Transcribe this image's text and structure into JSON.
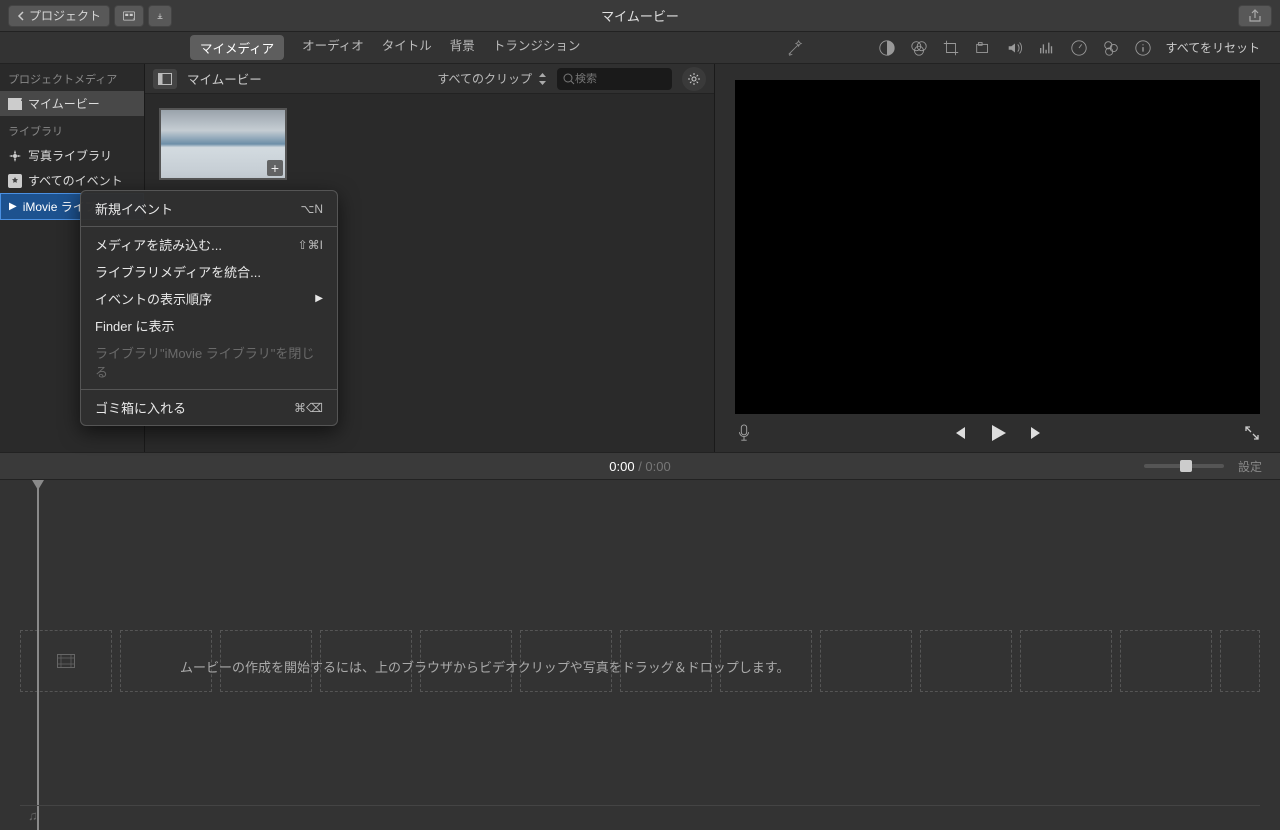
{
  "toolbar": {
    "back_label": "プロジェクト",
    "title": "マイムービー"
  },
  "tabs": {
    "my_media": "マイメディア",
    "audio": "オーディオ",
    "title": "タイトル",
    "bg": "背景",
    "transition": "トランジション"
  },
  "view_tools": {
    "reset_all": "すべてをリセット"
  },
  "sidebar": {
    "project_media_header": "プロジェクトメディア",
    "my_movie": "マイムービー",
    "library_header": "ライブラリ",
    "photo_library": "写真ライブラリ",
    "all_events": "すべてのイベント",
    "imovie_library": "iMovie ライブ..."
  },
  "browser": {
    "title": "マイムービー",
    "filter_label": "すべてのクリップ",
    "search_placeholder": "検索"
  },
  "context_menu": {
    "new_event": "新規イベント",
    "new_event_sc": "⌥N",
    "import_media": "メディアを読み込む...",
    "import_media_sc": "⇧⌘I",
    "consolidate": "ライブラリメディアを統合...",
    "sort_order": "イベントの表示順序",
    "show_in_finder": "Finder に表示",
    "close_library": "ライブラリ\"iMovie ライブラリ\"を閉じる",
    "trash": "ゴミ箱に入れる",
    "trash_sc": "⌘⌫"
  },
  "timeline": {
    "current": "0:00",
    "total": "0:00",
    "settings": "設定",
    "drop_msg": "ムービーの作成を開始するには、上のブラウザからビデオクリップや写真をドラッグ＆ドロップします。"
  }
}
